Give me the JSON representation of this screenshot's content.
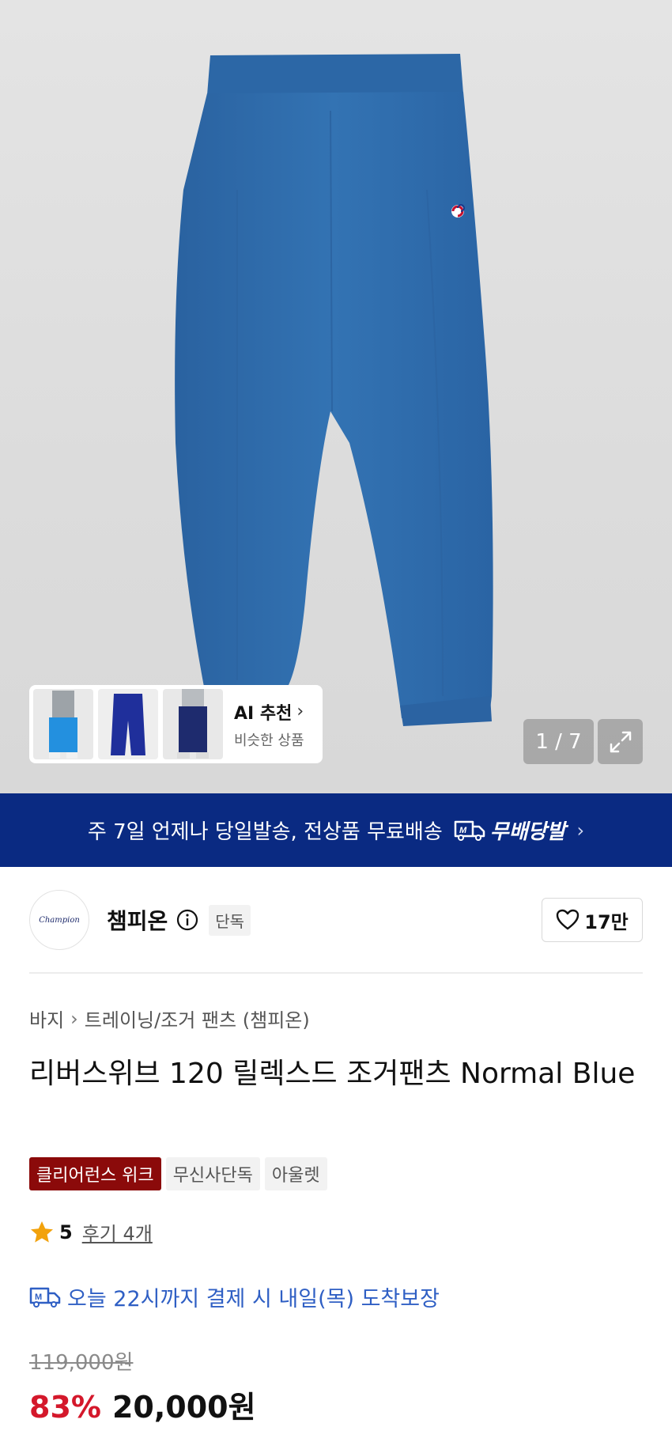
{
  "gallery": {
    "ai_card": {
      "title": "AI 추천",
      "subtitle": "비슷한 상품",
      "thumbnails": [
        "light-blue-pants-model",
        "navy-pants-flat",
        "navy-pants-model"
      ]
    },
    "counter": "1 / 7",
    "expand_icon": "expand-icon"
  },
  "banner": {
    "text": "주 7일 언제나 당일발송, 전상품 무료배송",
    "badge": "무배당발",
    "chevron": "›"
  },
  "brand": {
    "name": "챔피온",
    "logo_text": "Champion",
    "exclusive_tag": "단독",
    "likes": "17만"
  },
  "breadcrumb": {
    "level1": "바지",
    "separator": "›",
    "level2": "트레이닝/조거 팬츠 (챔피온)"
  },
  "product": {
    "title": "리버스위브 120 릴렉스드 조거팬츠 Normal Blue",
    "tags": [
      "클리어런스 위크",
      "무신사단독",
      "아울렛"
    ],
    "rating": "5",
    "reviews": "후기 4개",
    "delivery_text": "오늘 22시까지 결제 시 내일(목) 도착보장",
    "original_price": "119,000원",
    "discount": "83%",
    "price": "20,000원"
  },
  "colors": {
    "banner": "#0a2a82",
    "discount": "#d4182b",
    "delivery": "#2f5fc4",
    "clearance_tag": "#8b0a0a",
    "pants": "#2f6aa8"
  }
}
